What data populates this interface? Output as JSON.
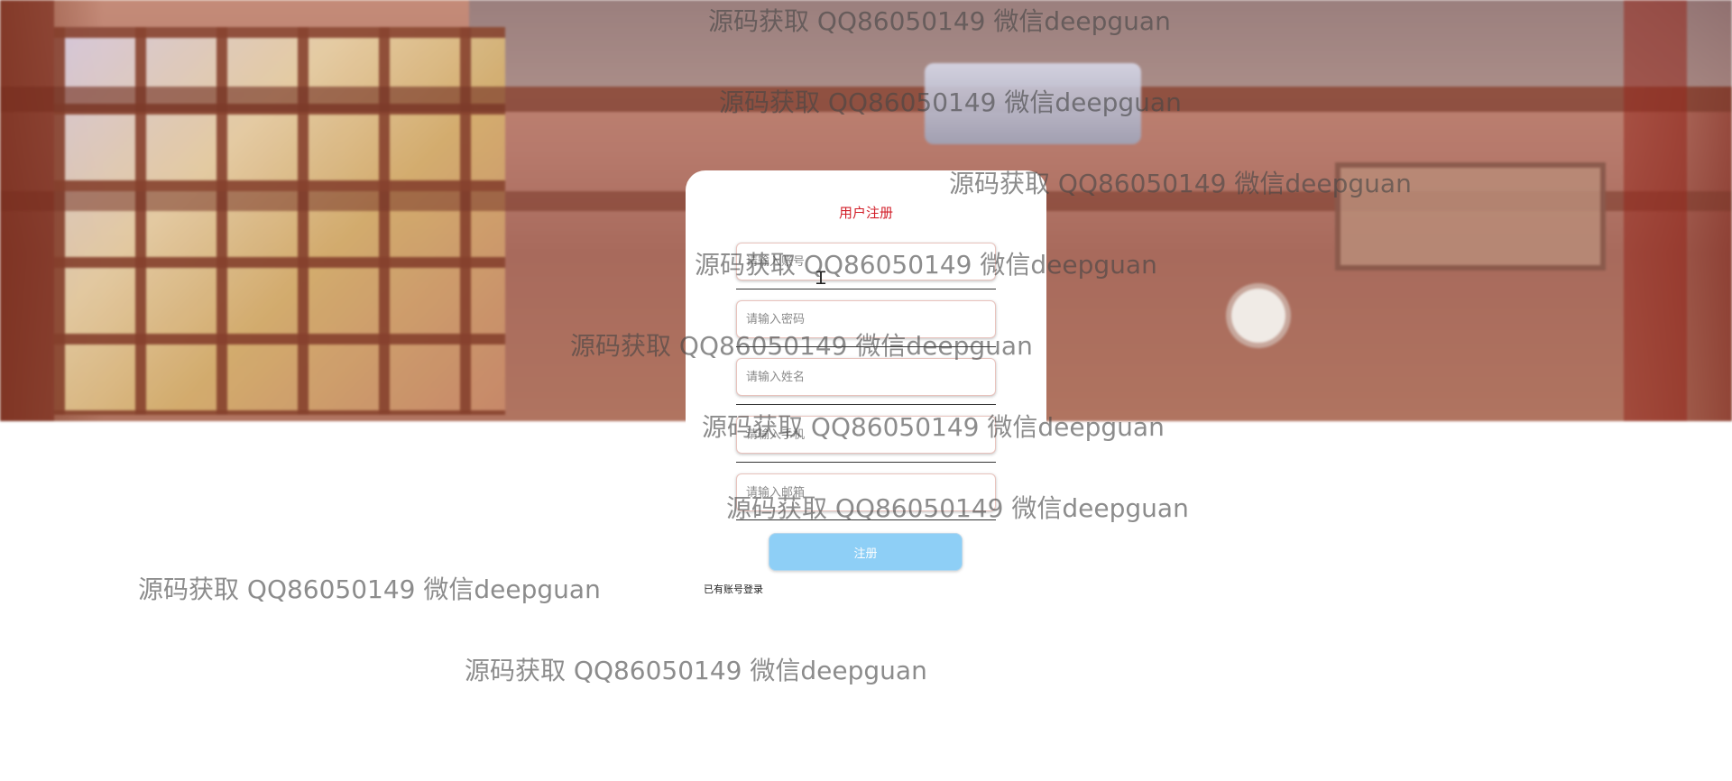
{
  "register": {
    "title": "用户注册",
    "fields": [
      {
        "placeholder": "请输入账号",
        "value": ""
      },
      {
        "placeholder": "请输入密码",
        "value": ""
      },
      {
        "placeholder": "请输入姓名",
        "value": ""
      },
      {
        "placeholder": "请输入手机",
        "value": ""
      },
      {
        "placeholder": "请输入邮箱",
        "value": ""
      }
    ],
    "submit_label": "注册",
    "login_link": "已有账号登录"
  },
  "watermark": {
    "text": "源码获取 QQ86050149 微信deepguan"
  },
  "colors": {
    "title": "#d21e28",
    "submit": "#8ecff6"
  }
}
